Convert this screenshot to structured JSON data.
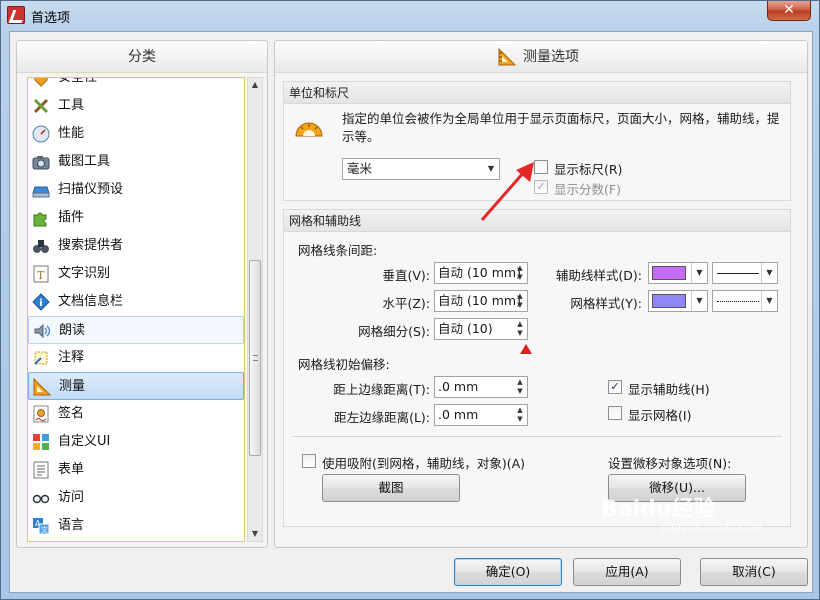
{
  "window": {
    "title": "首选项",
    "close_label": "✕"
  },
  "left": {
    "header": "分类",
    "items": [
      {
        "label": "安全性",
        "icon": "shield-icon"
      },
      {
        "label": "工具",
        "icon": "tools-icon"
      },
      {
        "label": "性能",
        "icon": "gauge-icon"
      },
      {
        "label": "截图工具",
        "icon": "camera-icon"
      },
      {
        "label": "扫描仪预设",
        "icon": "scanner-icon"
      },
      {
        "label": "插件",
        "icon": "puzzle-icon"
      },
      {
        "label": "搜索提供者",
        "icon": "binoculars-icon"
      },
      {
        "label": "文字识别",
        "icon": "ocr-icon"
      },
      {
        "label": "文档信息栏",
        "icon": "info-icon"
      },
      {
        "label": "朗读",
        "icon": "speaker-icon"
      },
      {
        "label": "注释",
        "icon": "annotation-icon"
      },
      {
        "label": "测量",
        "icon": "ruler-icon"
      },
      {
        "label": "签名",
        "icon": "signature-icon"
      },
      {
        "label": "自定义UI",
        "icon": "customize-ui-icon"
      },
      {
        "label": "表单",
        "icon": "form-icon"
      },
      {
        "label": "访问",
        "icon": "glasses-icon"
      },
      {
        "label": "语言",
        "icon": "language-icon"
      }
    ],
    "selected_index": 11,
    "hover_index": 9
  },
  "right": {
    "title": "测量选项",
    "units_group": {
      "header": "单位和标尺",
      "description": "指定的单位会被作为全局单位用于显示页面标尺，页面大小，网格，辅助线，提示等。",
      "unit_value": "毫米",
      "show_ruler_label": "显示标尺(R)",
      "show_ruler_checked": false,
      "show_fraction_label": "显示分数(F)",
      "show_fraction_checked": true
    },
    "grid_group": {
      "header": "网格和辅助线",
      "spacing_label": "网格线条间距:",
      "vertical_label": "垂直(V):",
      "vertical_value": "自动 (10 mm)",
      "horizontal_label": "水平(Z):",
      "horizontal_value": "自动 (10 mm)",
      "subdivision_label": "网格细分(S):",
      "subdivision_value": "自动 (10)",
      "guide_style_label": "辅助线样式(D):",
      "guide_color": "#c46cf3",
      "grid_style_label": "网格样式(Y):",
      "grid_color": "#8f86f7",
      "offset_label": "网格线初始偏移:",
      "top_offset_label": "距上边缘距离(T):",
      "top_offset_value": ".0 mm",
      "left_offset_label": "距左边缘距离(L):",
      "left_offset_value": ".0 mm",
      "show_guides_label": "显示辅助线(H)",
      "show_guides_checked": true,
      "show_grid_label": "显示网格(I)",
      "show_grid_checked": false,
      "snap_label": "使用吸附(到网格，辅助线，对象)(A)",
      "snap_checked": false,
      "screenshot_button": "截图",
      "nudge_settings_label": "设置微移对象选项(N):",
      "nudge_button": "微移(U)..."
    }
  },
  "footer": {
    "ok": "确定(O)",
    "apply": "应用(A)",
    "cancel": "取消(C)"
  },
  "watermark": {
    "brand": "Baidu经验",
    "url": "jingyan.baidu.com"
  }
}
